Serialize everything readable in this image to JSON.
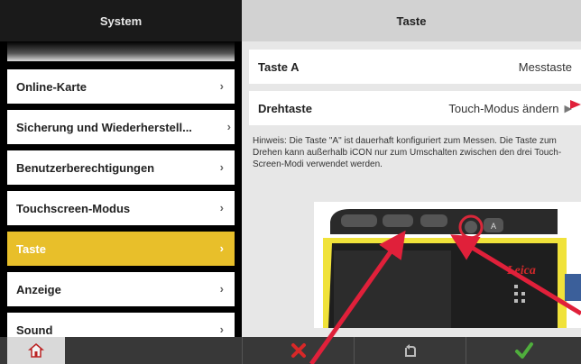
{
  "left_panel": {
    "title": "System",
    "items": [
      {
        "label": "Online-Karte",
        "active": false
      },
      {
        "label": "Sicherung und Wiederherstell...",
        "active": false
      },
      {
        "label": "Benutzerberechtigungen",
        "active": false
      },
      {
        "label": "Touchscreen-Modus",
        "active": false
      },
      {
        "label": "Taste",
        "active": true
      },
      {
        "label": "Anzeige",
        "active": false
      },
      {
        "label": "Sound",
        "active": false
      }
    ],
    "chevron": "›"
  },
  "right_panel": {
    "title": "Taste",
    "rows": [
      {
        "label": "Taste A",
        "value": "Messtaste"
      },
      {
        "label": "Drehtaste",
        "value": "Touch-Modus ändern"
      }
    ],
    "row_arrow": "▶",
    "hint": "Hinweis: Die Taste \"A\" ist dauerhaft konfiguriert zum Messen. Die Taste zum Drehen kann außerhalb iCON nur zum Umschalten zwischen den drei Touch-Screen-Modi verwendet werden.",
    "device_brand": "Leica",
    "device_key_label": "A"
  },
  "bottom_bar": {
    "home_icon": "home-icon",
    "cancel_icon": "cancel-x-icon",
    "undo_icon": "undo-icon",
    "ok_icon": "checkmark-icon"
  },
  "colors": {
    "accent_yellow": "#e8bf2a",
    "annotation_red": "#e0203a",
    "cancel_red": "#d82828",
    "ok_green": "#4fae3c"
  }
}
